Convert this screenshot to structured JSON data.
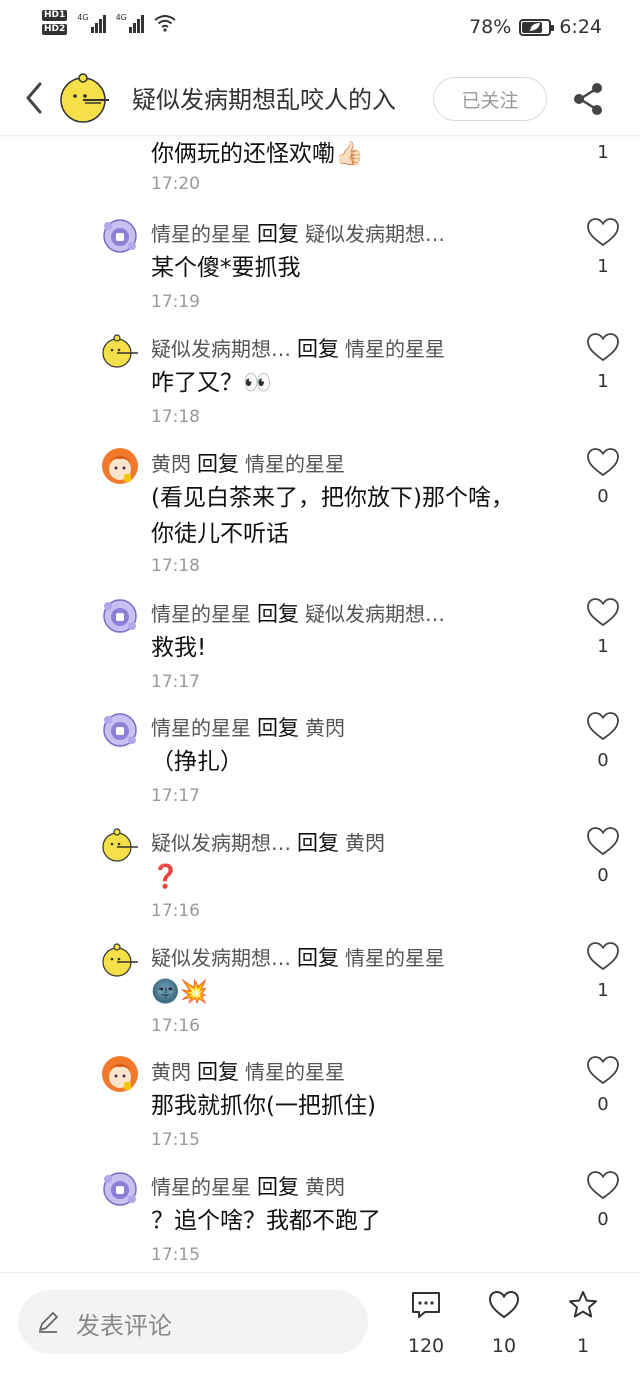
{
  "status": {
    "hd1": "HD1",
    "hd2": "HD2",
    "net1": "4G",
    "net2": "4G",
    "battery": "78%",
    "battery_level": 0.78,
    "time": "6:24"
  },
  "header": {
    "title": "疑似发病期想乱咬人的入",
    "follow_label": "已关注"
  },
  "comments": [
    {
      "avatar": "lemon",
      "user": "",
      "reply_word": "",
      "target": "",
      "text": "你俩玩的还怪欢嘞👍🏻",
      "time": "17:20",
      "likes": "1"
    },
    {
      "avatar": "purple",
      "user": "情星的星星",
      "reply_word": "回复",
      "target": "疑似发病期想…",
      "text": "某个傻*要抓我",
      "time": "17:19",
      "likes": "1"
    },
    {
      "avatar": "lemon",
      "user": "疑似发病期想…",
      "reply_word": "回复",
      "target": "情星的星星",
      "text": "咋了又？👀",
      "time": "17:18",
      "likes": "1"
    },
    {
      "avatar": "orange",
      "user": "黄閃",
      "reply_word": "回复",
      "target": "情星的星星",
      "text": "(看见白茶来了，把你放下)那个啥，你徒儿不听话",
      "time": "17:18",
      "likes": "0"
    },
    {
      "avatar": "purple",
      "user": "情星的星星",
      "reply_word": "回复",
      "target": "疑似发病期想…",
      "text": "救我!",
      "time": "17:17",
      "likes": "1"
    },
    {
      "avatar": "purple",
      "user": "情星的星星",
      "reply_word": "回复",
      "target": "黄閃",
      "text": "（挣扎）",
      "time": "17:17",
      "likes": "0"
    },
    {
      "avatar": "lemon",
      "user": "疑似发病期想…",
      "reply_word": "回复",
      "target": "黄閃",
      "text": "❓",
      "time": "17:16",
      "likes": "0"
    },
    {
      "avatar": "lemon",
      "user": "疑似发病期想…",
      "reply_word": "回复",
      "target": "情星的星星",
      "text": "🌚💥",
      "time": "17:16",
      "likes": "1"
    },
    {
      "avatar": "orange",
      "user": "黄閃",
      "reply_word": "回复",
      "target": "情星的星星",
      "text": "那我就抓你(一把抓住)",
      "time": "17:15",
      "likes": "0"
    },
    {
      "avatar": "purple",
      "user": "情星的星星",
      "reply_word": "回复",
      "target": "黄閃",
      "text": "？追个啥？我都不跑了",
      "time": "17:15",
      "likes": "0"
    }
  ],
  "bottom": {
    "placeholder": "发表评论",
    "comments_count": "120",
    "likes_count": "10",
    "favorites_count": "1"
  }
}
